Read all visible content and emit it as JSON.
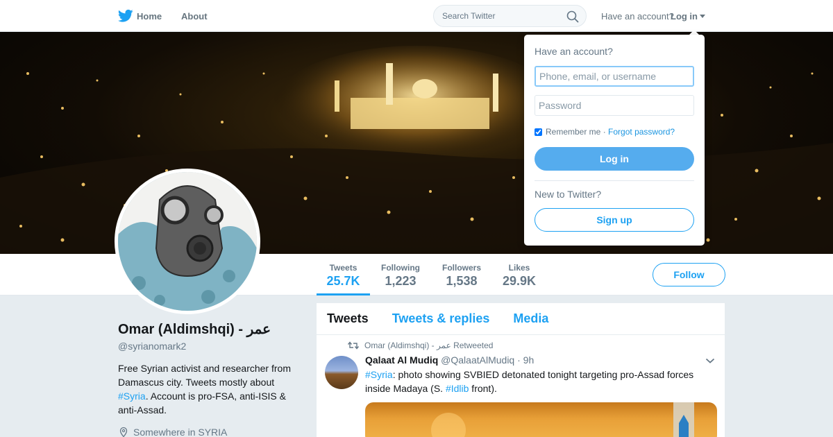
{
  "nav": {
    "home_label": "Home",
    "about_label": "About",
    "search_placeholder": "Search Twitter",
    "account_prompt": "Have an account?",
    "login_label": "Log in"
  },
  "profile_nav": {
    "stats": [
      {
        "label": "Tweets",
        "value": "25.7K"
      },
      {
        "label": "Following",
        "value": "1,223"
      },
      {
        "label": "Followers",
        "value": "1,538"
      },
      {
        "label": "Likes",
        "value": "29.9K"
      }
    ],
    "follow_label": "Follow"
  },
  "profile": {
    "name": "Omar (Aldimshqi) - عمر",
    "handle": "@syrianomark2",
    "bio_part1": "Free Syrian activist and researcher from Damascus city. Tweets mostly about ",
    "bio_tag": "#Syria",
    "bio_part2": ". Account is pro-FSA, anti-ISIS & anti-Assad.",
    "location": "Somewhere in SYRIA"
  },
  "timeline": {
    "tabs": [
      "Tweets",
      "Tweets & replies",
      "Media"
    ],
    "tweet": {
      "retweeted_by": "Omar (Aldimshqi) - عمر Retweeted",
      "fullname": "Qalaat Al Mudiq",
      "username": "@QalaatAlMudiq",
      "separator": "·",
      "time": "9h",
      "text_tag1": "#Syria",
      "text_part1": ": photo showing SVBIED detonated tonight targeting pro-Assad forces inside Madaya (S. ",
      "text_tag2": "#Idlib",
      "text_part2": " front)."
    }
  },
  "login_dropdown": {
    "title": "Have an account?",
    "username_placeholder": "Phone, email, or username",
    "password_placeholder": "Password",
    "remember_label": "Remember me",
    "separator": "·",
    "forgot_label": "Forgot password?",
    "login_button": "Log in",
    "new_prompt": "New to Twitter?",
    "signup_button": "Sign up"
  },
  "colors": {
    "accent": "#1da1f2",
    "login_button": "#55acee"
  }
}
